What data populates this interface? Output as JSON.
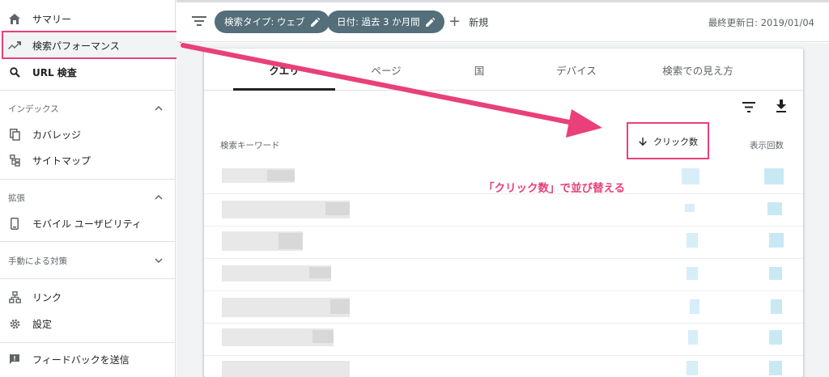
{
  "sidebar": {
    "items": {
      "summary": {
        "label": "サマリー",
        "icon": "home-icon"
      },
      "performance": {
        "label": "検索パフォーマンス",
        "icon": "trending-up-icon"
      },
      "url_inspection": {
        "label": "URL 検査",
        "icon": "search-icon"
      },
      "coverage": {
        "label": "カバレッジ",
        "icon": "copy-icon"
      },
      "sitemaps": {
        "label": "サイトマップ",
        "icon": "sitemap-icon"
      },
      "mobile_usability": {
        "label": "モバイル ユーザビリティ",
        "icon": "phone-icon"
      },
      "links": {
        "label": "リンク",
        "icon": "network-icon"
      },
      "settings": {
        "label": "設定",
        "icon": "gear-icon"
      },
      "feedback": {
        "label": "フィードバックを送信",
        "icon": "feedback-icon"
      }
    },
    "sections": {
      "index": "インデックス",
      "enhancements": "拡張",
      "manual_actions": "手動による対策"
    }
  },
  "topbar": {
    "chips": {
      "search_type": "検索タイプ: ウェブ",
      "date": "日付: 過去 3 か月間"
    },
    "new_label": "新規",
    "last_updated": "最終更新日: 2019/01/04"
  },
  "card": {
    "tabs": {
      "queries": "クエリ",
      "pages": "ページ",
      "countries": "国",
      "devices": "デバイス",
      "search_appearance": "検索での見え方"
    },
    "columns": {
      "keyword": "検索キーワード",
      "clicks": "クリック数",
      "impressions": "表示回数"
    }
  },
  "annotation": {
    "text": "「クリック数」で並び替える",
    "color": "#e9407a"
  },
  "colors": {
    "chip_bg": "#546e7a",
    "highlight": "#e9407a"
  }
}
